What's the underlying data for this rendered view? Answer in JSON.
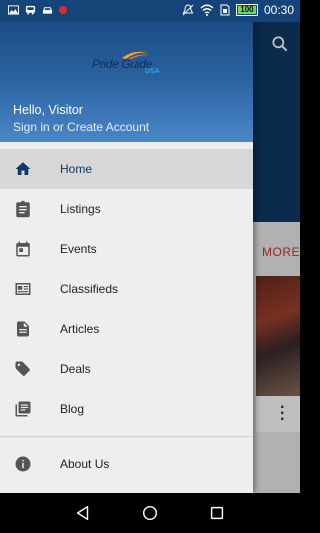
{
  "status_bar": {
    "time": "00:30",
    "battery": "100"
  },
  "background": {
    "more_label": "MORE"
  },
  "drawer": {
    "logo_text": "Pride Guide",
    "logo_sub": "USA",
    "greeting": "Hello, Visitor",
    "signin": "Sign in or Create Account",
    "items": [
      {
        "label": "Home",
        "icon": "home-icon"
      },
      {
        "label": "Listings",
        "icon": "clipboard-icon"
      },
      {
        "label": "Events",
        "icon": "calendar-icon"
      },
      {
        "label": "Classifieds",
        "icon": "news-card-icon"
      },
      {
        "label": "Articles",
        "icon": "document-icon"
      },
      {
        "label": "Deals",
        "icon": "tags-icon"
      },
      {
        "label": "Blog",
        "icon": "library-books-icon"
      }
    ],
    "about_label": "About Us"
  },
  "colors": {
    "primary": "#0e3a66",
    "accent": "#d32f2f",
    "active_row": "#d7d7d7"
  }
}
